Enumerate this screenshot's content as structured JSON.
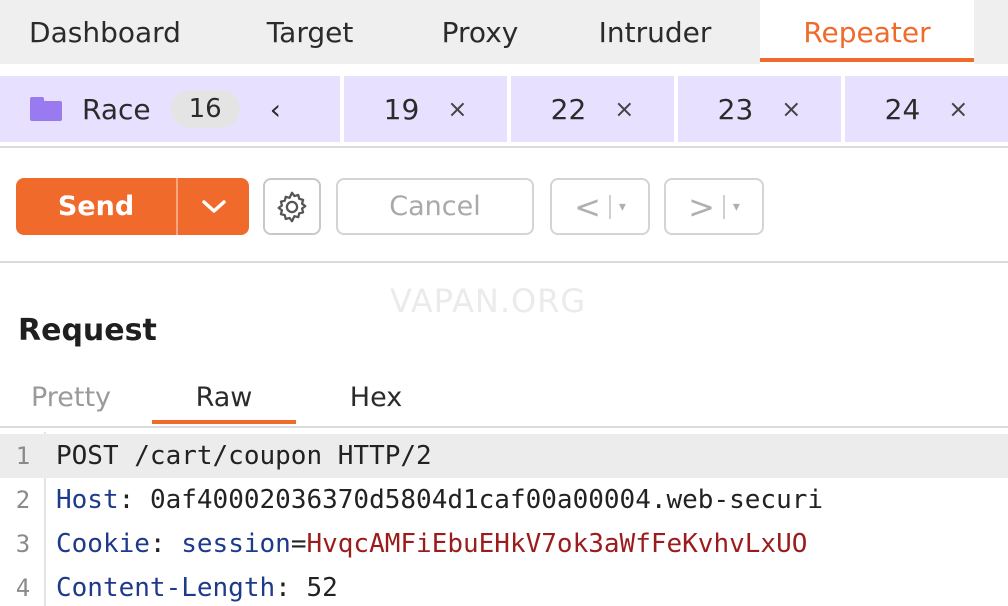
{
  "top_tabs": [
    {
      "label": "Dashboard"
    },
    {
      "label": "Target"
    },
    {
      "label": "Proxy"
    },
    {
      "label": "Intruder"
    },
    {
      "label": "Repeater"
    }
  ],
  "repeater_tabs": {
    "group_name": "Race",
    "group_count": "16",
    "scroll_left": "‹",
    "tabs": [
      {
        "label": "19",
        "close": "×"
      },
      {
        "label": "22",
        "close": "×"
      },
      {
        "label": "23",
        "close": "×"
      },
      {
        "label": "24",
        "close": "×"
      }
    ]
  },
  "toolbar": {
    "send_label": "Send",
    "cancel_label": "Cancel",
    "back_arrow": "<",
    "forward_arrow": ">",
    "caret": "▾"
  },
  "watermark": "VAPAN.ORG",
  "request": {
    "title": "Request",
    "view_tabs": [
      {
        "label": "Pretty"
      },
      {
        "label": "Raw"
      },
      {
        "label": "Hex"
      }
    ],
    "lines": [
      {
        "num": "1",
        "text": "POST /cart/coupon HTTP/2"
      },
      {
        "num": "2",
        "key": "Host",
        "sep": ": ",
        "value": "0af40002036370d5804d1caf00a00004.web-securi"
      },
      {
        "num": "3",
        "key": "Cookie",
        "sep": ": ",
        "subkey": "session",
        "eq": "=",
        "value": "HvqcAMFiEbuEHkV7ok3aWfFeKvhvLxUO"
      },
      {
        "num": "4",
        "key": "Content-Length",
        "sep": ": ",
        "value": "52"
      }
    ]
  },
  "colors": {
    "accent": "#f06a2b",
    "tab_lilac": "#e7e0ff",
    "folder": "#9a7af0",
    "header_key": "#1e3a8a",
    "cookie_value": "#9b1c1c"
  }
}
